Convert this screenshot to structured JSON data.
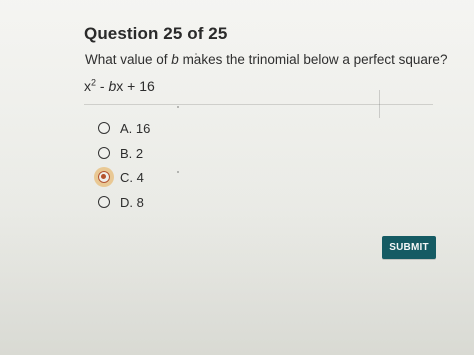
{
  "question": {
    "header": "Question 25 of 25",
    "prompt_before_b": "What value of ",
    "prompt_b": "b",
    "prompt_after_b": " makes the trinomial below a perfect square?",
    "expression": {
      "x": "x",
      "power": "2",
      "rest_prefix": " - ",
      "b": "b",
      "rest_suffix": "x + 16"
    }
  },
  "options": [
    {
      "label": "A. 16",
      "selected": false
    },
    {
      "label": "B. 2",
      "selected": false
    },
    {
      "label": "C. 4",
      "selected": true
    },
    {
      "label": "D. 8",
      "selected": false
    }
  ],
  "submit": {
    "label": "SUBMIT"
  },
  "colors": {
    "primary_button": "#155b63",
    "selected_radio": "#b4532d",
    "selected_glow": "#e8ac4e",
    "text": "#2b2b2b",
    "separator": "#cfcfcb"
  }
}
